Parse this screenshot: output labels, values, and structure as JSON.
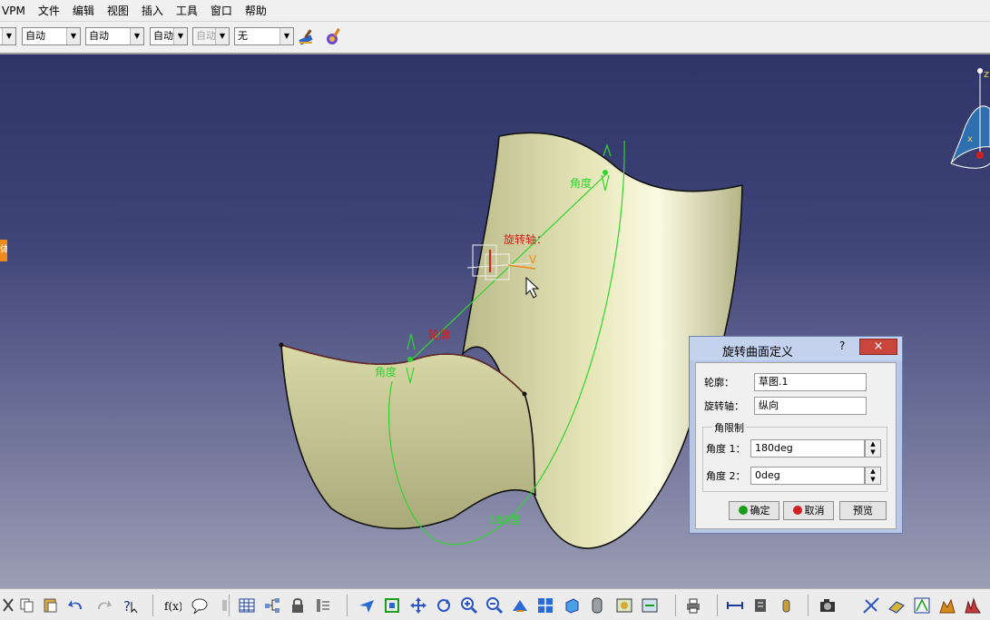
{
  "menu": [
    "VPM",
    "文件",
    "编辑",
    "视图",
    "插入",
    "工具",
    "窗口",
    "帮助"
  ],
  "toolbar": {
    "combos": [
      "",
      "自动",
      "自动",
      "自动",
      "自动",
      "无"
    ]
  },
  "viewport": {
    "labels": {
      "angle_top": "角度",
      "axis": "旋转轴：",
      "profile": "轮廓",
      "angle_left": "角度",
      "angle_value": "180度",
      "axis_letter": "V",
      "compass_z": "z",
      "compass_x": "x"
    }
  },
  "dialog": {
    "title": "旋转曲面定义",
    "help": "?",
    "close": "×",
    "profile_label": "轮廓：",
    "profile_value": "草图.1",
    "axis_label": "旋转轴：",
    "axis_value": "纵向",
    "group_title": "角限制",
    "angle1_label": "角度 1：",
    "angle1_value": "180deg",
    "angle2_label": "角度 2：",
    "angle2_value": "0deg",
    "ok": "确定",
    "cancel": "取消",
    "preview": "预览"
  },
  "colors": {
    "accent_green": "#2fd52f",
    "axis_red": "#e01818",
    "surface": "#d6d6a2"
  }
}
